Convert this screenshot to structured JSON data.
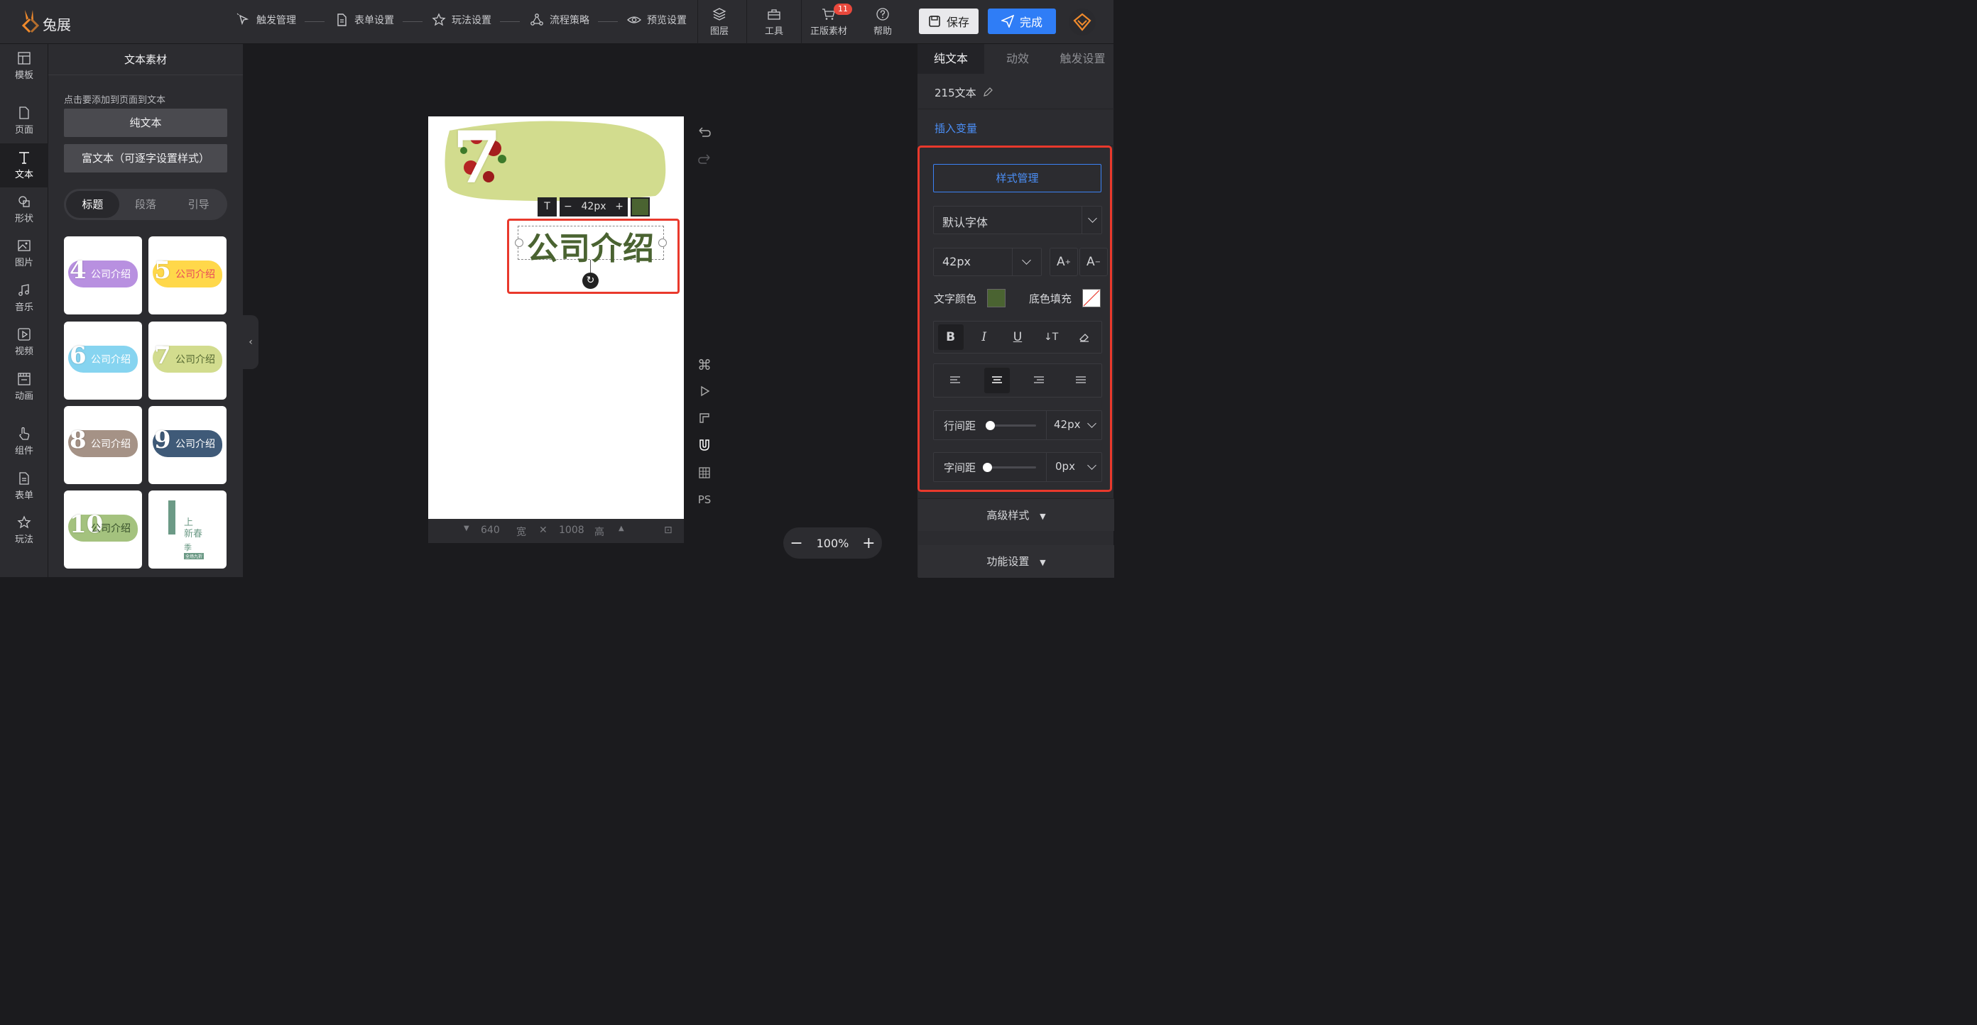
{
  "app": {
    "name": "兔展"
  },
  "steps": [
    "触发管理",
    "表单设置",
    "玩法设置",
    "流程策略",
    "预览设置"
  ],
  "tools": {
    "layers": "图层",
    "tools": "工具",
    "materials": "正版素材",
    "materials_badge": "11",
    "help": "帮助"
  },
  "buttons": {
    "save": "保存",
    "done": "完成"
  },
  "rail": [
    "模板",
    "页面",
    "文本",
    "形状",
    "图片",
    "音乐",
    "视频",
    "动画",
    "组件",
    "表单",
    "玩法"
  ],
  "panel": {
    "title": "文本素材",
    "hint": "点击要添加到页面到文本",
    "plain_text": "纯文本",
    "rich_text": "富文本（可逐字设置样式）",
    "tabs": [
      "标题",
      "段落",
      "引导"
    ],
    "thumbs": [
      {
        "num": "4",
        "text": "公司介绍",
        "color": "#b890e0",
        "text_color": "#ffffff"
      },
      {
        "num": "5",
        "text": "公司介绍",
        "color": "#ffd84a",
        "text_color": "#e94a5a"
      },
      {
        "num": "6",
        "text": "公司介绍",
        "color": "#86d4f0",
        "text_color": "#ffffff"
      },
      {
        "num": "7",
        "text": "公司介绍",
        "color": "#d2dc8e",
        "text_color": "#566a32"
      },
      {
        "num": "8",
        "text": "公司介绍",
        "color": "#a59286",
        "text_color": "#ffffff"
      },
      {
        "num": "9",
        "text": "公司介绍",
        "color": "#3f5a78",
        "text_color": "#ffffff"
      },
      {
        "num": "10",
        "text": "公司介绍",
        "color": "#a4c27e",
        "text_color": "#37502a"
      }
    ],
    "thumb_last": {
      "line1": "上",
      "line2": "新春",
      "line3": "季",
      "tag": "全场九折"
    }
  },
  "canvas": {
    "title_text": "公司介绍",
    "number": "7",
    "font_size": "42px",
    "width": "640",
    "width_label": "宽",
    "height": "1008",
    "height_label": "高",
    "zoom": "100%",
    "ps_label": "PS"
  },
  "right": {
    "tabs": [
      "纯文本",
      "动效",
      "触发设置"
    ],
    "element_name": "215文本",
    "insert_var": "插入变量",
    "style_manage": "样式管理",
    "font": "默认字体",
    "font_size": "42px",
    "text_color_label": "文字颜色",
    "text_color": "#4a6331",
    "bg_fill_label": "底色填充",
    "line_height_label": "行间距",
    "line_height": "42px",
    "letter_spacing_label": "字间距",
    "letter_spacing": "0px",
    "advanced": "高级样式",
    "function": "功能设置"
  }
}
